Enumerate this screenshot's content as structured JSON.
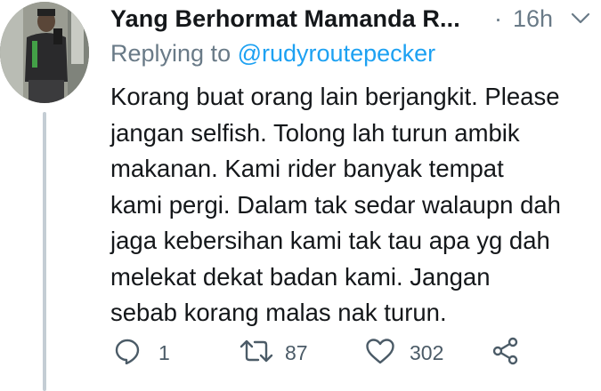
{
  "tweet": {
    "display_name": "Yang Berhormat Mamanda R...",
    "separator": "·",
    "time": "16h",
    "reply_prefix": "Replying to",
    "reply_handle": "@rudyroutepecker",
    "text_lines": [
      "Korang buat orang lain berjangkit. Please",
      "jangan selfish. Tolong lah turun ambik",
      "makanan. Kami rider banyak tempat",
      "kami pergi. Dalam tak sedar walaupn dah",
      "jaga kebersihan kami tak tau apa yg dah",
      "melekat dekat badan kami. Jangan",
      "sebab korang malas nak turun."
    ]
  },
  "actions": {
    "replies": "1",
    "retweets": "87",
    "likes": "302"
  },
  "icons": {
    "reply": "reply-icon",
    "retweet": "retweet-icon",
    "like": "heart-icon",
    "share": "share-icon",
    "menu": "chevron-down-icon"
  },
  "colors": {
    "text": "#14171a",
    "muted": "#697a87",
    "link": "#1da1f2",
    "thread_line": "#c4cdd4"
  }
}
